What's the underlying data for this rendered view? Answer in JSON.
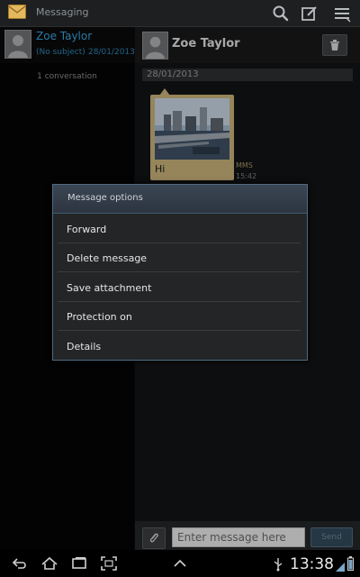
{
  "actionbar": {
    "title": "Messaging",
    "icons": [
      "envelope-icon",
      "search-icon",
      "compose-icon",
      "menu-icon"
    ]
  },
  "conversation_list": {
    "items": [
      {
        "name": "Zoe Taylor",
        "subject": "(No subject)",
        "date": "28/01/2013"
      }
    ],
    "count_label": "1 conversation"
  },
  "thread": {
    "contact_name": "Zoe Taylor",
    "date_divider": "28/01/2013",
    "message": {
      "text": "Hi",
      "type": "MMS",
      "time": "15:42"
    }
  },
  "compose": {
    "placeholder": "Enter message here",
    "value": "",
    "send_label": "Send"
  },
  "dialog": {
    "title": "Message options",
    "items": [
      {
        "label": "Forward"
      },
      {
        "label": "Delete message"
      },
      {
        "label": "Save attachment"
      },
      {
        "label": "Protection on"
      },
      {
        "label": "Details"
      }
    ]
  },
  "systembar": {
    "time": "13:38",
    "icons": [
      "back-icon",
      "home-icon",
      "recent-apps-icon",
      "screenshot-icon",
      "up-arrow-icon",
      "usb-icon",
      "signal-icon",
      "battery-icon"
    ]
  },
  "colors": {
    "accent_blue": "#3aa2de",
    "bubble": "#c8b27a",
    "dialog_border": "#4f6a80"
  }
}
